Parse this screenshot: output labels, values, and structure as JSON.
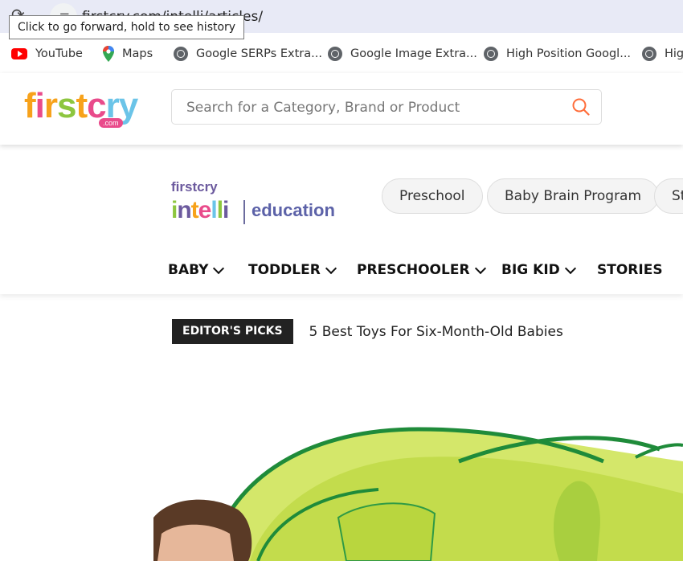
{
  "browser": {
    "url": "firstcry.com/intelli/articles/",
    "tooltip": "Click to go forward, hold to see history"
  },
  "bookmarks": [
    {
      "label": "YouTube",
      "icon": "youtube-icon"
    },
    {
      "label": "Maps",
      "icon": "maps-icon"
    },
    {
      "label": "Google SERPs Extra...",
      "icon": "globe-icon"
    },
    {
      "label": "Google Image Extra...",
      "icon": "globe-icon"
    },
    {
      "label": "High Position Googl...",
      "icon": "globe-icon"
    },
    {
      "label": "Hig",
      "icon": "globe-icon"
    }
  ],
  "header": {
    "logo_text": "firstcry",
    "logo_domain": ".com",
    "search_placeholder": "Search for a Category, Brand or Product"
  },
  "intelli": {
    "logo_top": "firstcry",
    "logo_main": "intelli",
    "logo_sub": "education",
    "pills": [
      "Preschool",
      "Baby Brain Program",
      "St"
    ],
    "nav": [
      {
        "label": "BABY",
        "dropdown": true
      },
      {
        "label": "TODDLER",
        "dropdown": true
      },
      {
        "label": "PRESCHOOLER",
        "dropdown": true
      },
      {
        "label": "BIG KID",
        "dropdown": true
      },
      {
        "label": "STORIES",
        "dropdown": false
      }
    ]
  },
  "picks": {
    "badge": "EDITOR'S PICKS",
    "headline": "5 Best Toys For Six-Month-Old Babies"
  },
  "colors": {
    "accent": "#ff6d3a",
    "intelli_purple": "#6c5a9e",
    "tunnel_green": "#c8e05a",
    "tunnel_rim": "#1f8b3a"
  }
}
